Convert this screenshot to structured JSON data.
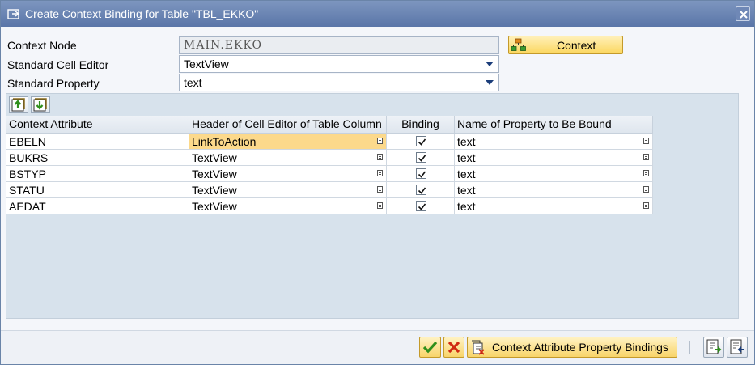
{
  "window": {
    "title": "Create Context Binding for Table \"TBL_EKKO\""
  },
  "form": {
    "context_node": {
      "label": "Context Node",
      "value": "MAIN.EKKO"
    },
    "cell_editor": {
      "label": "Standard Cell Editor",
      "value": "TextView"
    },
    "property": {
      "label": "Standard Property",
      "value": "text"
    },
    "context_button_label": "Context"
  },
  "table": {
    "columns": [
      "Context Attribute",
      "Header of Cell Editor of Table Column",
      "Binding",
      "Name of Property to Be Bound"
    ],
    "rows": [
      {
        "attribute": "EBELN",
        "editor": "LinkToAction",
        "binding": true,
        "property": "text"
      },
      {
        "attribute": "BUKRS",
        "editor": "TextView",
        "binding": true,
        "property": "text"
      },
      {
        "attribute": "BSTYP",
        "editor": "TextView",
        "binding": true,
        "property": "text"
      },
      {
        "attribute": "STATU",
        "editor": "TextView",
        "binding": true,
        "property": "text"
      },
      {
        "attribute": "AEDAT",
        "editor": "TextView",
        "binding": true,
        "property": "text"
      }
    ]
  },
  "footer": {
    "bindings_button_label": "Context Attribute Property Bindings"
  },
  "icons": {
    "window": "window-icon",
    "close": "close-icon",
    "context": "context-hierarchy-icon",
    "select_all": "select-all-icon",
    "deselect_all": "deselect-all-icon",
    "confirm": "checkmark-icon",
    "cancel": "cancel-icon",
    "bindings": "bindings-icon",
    "save_template": "save-template-icon",
    "load_template": "load-template-icon"
  },
  "colors": {
    "title_bar": "#5a76a8",
    "highlight_row_cell": "#fcd98b",
    "confirm_green": "#2f8f1b",
    "cancel_red": "#d02a12"
  }
}
